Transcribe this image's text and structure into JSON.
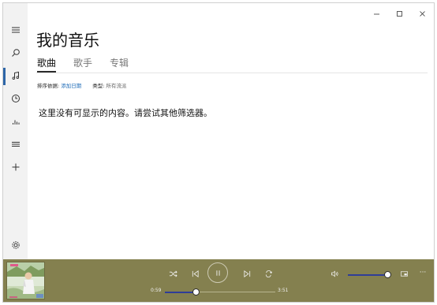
{
  "window": {
    "title_controls": {
      "minimize": "–",
      "maximize": "□",
      "close": "✕"
    }
  },
  "rail": {
    "items": [
      {
        "name": "menu-icon"
      },
      {
        "name": "search-icon"
      },
      {
        "name": "music-note-icon",
        "active": true
      },
      {
        "name": "clock-icon"
      },
      {
        "name": "equalizer-icon"
      },
      {
        "name": "playlist-icon"
      },
      {
        "name": "plus-icon"
      }
    ],
    "settings": {
      "name": "gear-icon"
    }
  },
  "main": {
    "title": "我的音乐",
    "tabs": [
      {
        "label": "歌曲",
        "selected": true
      },
      {
        "label": "歌手",
        "selected": false
      },
      {
        "label": "专辑",
        "selected": false
      }
    ],
    "sort": {
      "label": "排序依据:",
      "value": "添加日期"
    },
    "genre": {
      "label": "类型:",
      "value": "所有流派"
    },
    "empty_message": "这里没有可显示的内容。请尝试其他筛选器。"
  },
  "player": {
    "current_time": "0:59",
    "total_time": "3:51",
    "progress": 0.28,
    "volume": 0.97,
    "more_label": "···"
  },
  "colors": {
    "player_bg": "#84804f",
    "accent": "#2f3d98",
    "link": "#1f6cb8"
  }
}
